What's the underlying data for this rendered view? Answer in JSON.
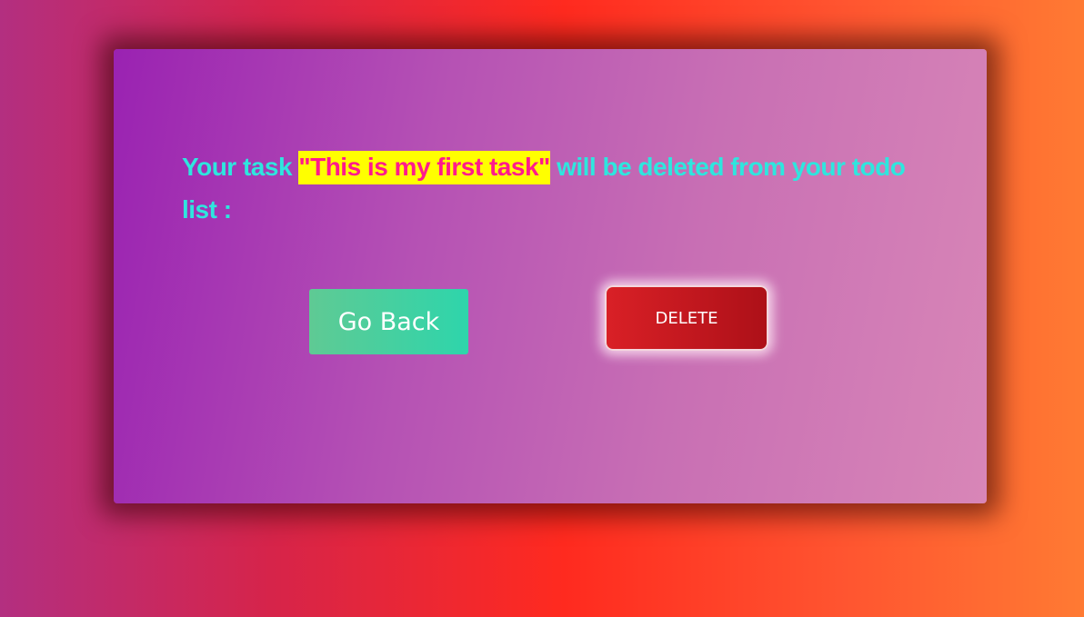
{
  "dialog": {
    "message_before": "Your task ",
    "task_name": "\"This is my first task\"",
    "message_after": " will be deleted from your todo list :"
  },
  "buttons": {
    "go_back_label": "Go Back",
    "delete_label": "DELETE"
  },
  "colors": {
    "message_text": "#2ee6de",
    "highlight_background": "#ffff00",
    "highlight_text": "#ff1a8c",
    "delete_button": "#d92026",
    "go_back_button": "#2ed5ab"
  }
}
